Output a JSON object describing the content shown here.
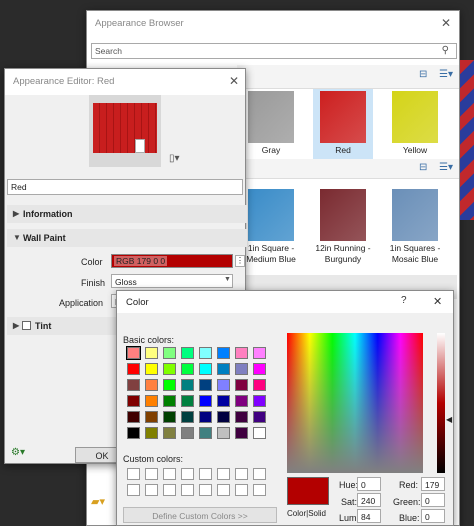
{
  "browser": {
    "title": "Appearance Browser",
    "search_placeholder": "Search",
    "top_items": [
      {
        "label": "Gray",
        "color": "#9a9a9a"
      },
      {
        "label": "Red",
        "color": "#cc1f1f"
      },
      {
        "label": "Yellow",
        "color": "#d4d418"
      }
    ],
    "grid_items": [
      {
        "label": "1in Square -\nMedium Blue",
        "color": "#3a8cc8"
      },
      {
        "label": "12in Running -\nBurgundy",
        "color": "#7a2a30"
      },
      {
        "label": "1in Squares -\nMosaic Blue",
        "color": "#6a8fb8"
      }
    ]
  },
  "editor": {
    "title": "Appearance Editor: Red",
    "name_value": "Red",
    "sections": {
      "information": "Information",
      "wall_paint": "Wall Paint",
      "tint": "Tint"
    },
    "color_label": "Color",
    "color_value": "RGB 179 0 0",
    "finish_label": "Finish",
    "finish_value": "Gloss",
    "application_label": "Application",
    "application_value": "B",
    "ok_label": "OK"
  },
  "color_dialog": {
    "title": "Color",
    "help": "?",
    "basic_label": "Basic colors:",
    "custom_label": "Custom colors:",
    "define_label": "Define Custom Colors >>",
    "color_solid_label": "Color|Solid",
    "hue_label": "Hue:",
    "hue_value": "0",
    "sat_label": "Sat:",
    "sat_value": "240",
    "lum_label": "Lum:",
    "lum_value": "84",
    "red_label": "Red:",
    "red_value": "179",
    "green_label": "Green:",
    "green_value": "0",
    "blue_label": "Blue:",
    "blue_value": "0",
    "current_color": "#b30000",
    "basic_colors": [
      "#ff8080",
      "#ffff80",
      "#80ff80",
      "#00ff80",
      "#80ffff",
      "#0080ff",
      "#ff80c0",
      "#ff80ff",
      "#ff0000",
      "#ffff00",
      "#80ff00",
      "#00ff40",
      "#00ffff",
      "#0080c0",
      "#8080c0",
      "#ff00ff",
      "#804040",
      "#ff8040",
      "#00ff00",
      "#008080",
      "#004080",
      "#8080ff",
      "#800040",
      "#ff0080",
      "#800000",
      "#ff8000",
      "#008000",
      "#008040",
      "#0000ff",
      "#0000a0",
      "#800080",
      "#8000ff",
      "#400000",
      "#804000",
      "#004000",
      "#004040",
      "#000080",
      "#000040",
      "#400040",
      "#400080",
      "#000000",
      "#808000",
      "#808040",
      "#808080",
      "#408080",
      "#c0c0c0",
      "#400040",
      "#ffffff"
    ]
  }
}
